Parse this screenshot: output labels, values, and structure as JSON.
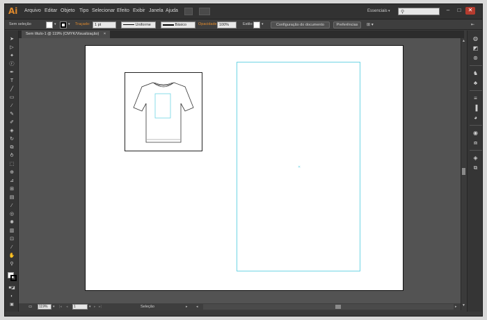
{
  "app": {
    "logo": "Ai"
  },
  "menu": [
    "Arquivo",
    "Editar",
    "Objeto",
    "Tipo",
    "Selecionar",
    "Efeito",
    "Exibir",
    "Janela",
    "Ajuda"
  ],
  "workspace": {
    "label": "Essenciais"
  },
  "search": {
    "icon": "search-icon"
  },
  "control_bar": {
    "selection_label": "Sem seleção",
    "stroke_label": "Traçado:",
    "stroke_weight": "1 pt",
    "profile_value": "Uniforme",
    "brush_value": "Básico",
    "opacity_label": "Opacidade:",
    "opacity_value": "100%",
    "style_label": "Estilo:",
    "doc_setup_button": "Configuração do documento",
    "preferences_button": "Preferências"
  },
  "document_tab": {
    "title": "Sem título-1 @ 119% (CMYK/Visualização)",
    "close": "×"
  },
  "status_bar": {
    "zoom": "119%",
    "artboard_number": "1",
    "status_text": "Seleção"
  },
  "colors": {
    "logo_orange": "#e08a2c",
    "guide_cyan": "#6ed4e4",
    "canvas_gray": "#535353",
    "artboard_white": "#ffffff"
  },
  "tools": [
    "selection-tool-icon",
    "direct-selection-tool-icon",
    "magic-wand-icon",
    "lasso-icon",
    "pen-icon",
    "type-icon",
    "line-icon",
    "rectangle-icon",
    "paintbrush-icon",
    "pencil-icon",
    "blob-brush-icon",
    "eraser-icon",
    "rotate-icon",
    "scale-icon",
    "warp-icon",
    "free-transform-icon",
    "shape-builder-icon",
    "perspective-grid-icon",
    "mesh-icon",
    "gradient-icon",
    "eyedropper-icon",
    "blend-icon",
    "symbol-sprayer-icon",
    "column-graph-icon",
    "artboard-icon",
    "slice-icon",
    "hand-icon",
    "zoom-icon"
  ],
  "right_panel_icons": [
    "color-icon",
    "color-guide-icon",
    "swatches-icon",
    "brushes-icon",
    "symbols-icon",
    "stroke-icon",
    "gradient-panel-icon",
    "transparency-icon",
    "appearance-icon",
    "graphic-styles-icon",
    "layers-icon",
    "artboards-icon"
  ]
}
